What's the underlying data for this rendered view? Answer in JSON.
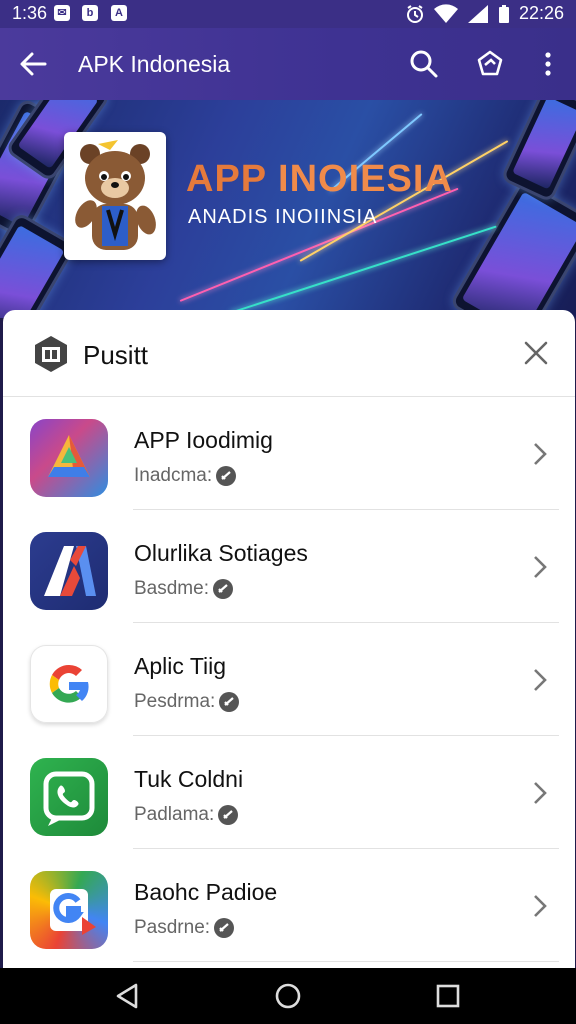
{
  "status_bar": {
    "time_left": "1:36",
    "notifications": [
      "✉",
      "b",
      "A"
    ],
    "time_right": "22:26",
    "icons": [
      "alarm-icon",
      "wifi-icon",
      "signal-icon",
      "battery-icon"
    ]
  },
  "app_bar": {
    "title": "APK Indonesia",
    "back_icon": "arrow-left-icon",
    "actions": [
      "search-icon",
      "share-icon",
      "more-vert-icon"
    ]
  },
  "banner": {
    "headline_part1": "APP ",
    "headline_part2": "INOIESIA",
    "subtitle": "ANADIS INOIINSIA",
    "mascot": "bear-mascot"
  },
  "sheet": {
    "title": "Pusitt",
    "header_icon": "app-box-icon",
    "close_icon": "close-icon",
    "items": [
      {
        "name": "APP Ioodimig",
        "meta": "Inadcma:",
        "icon": "triangle-app-icon",
        "colors": [
          "#8a44c8",
          "#2f8de0"
        ]
      },
      {
        "name": "Olurlika Sotiages",
        "meta": "Basdme:",
        "icon": "a-letter-app-icon",
        "colors": [
          "#2c3c8f",
          "#1e2c72"
        ]
      },
      {
        "name": "Aplic Tiig",
        "meta": "Pesdrma:",
        "icon": "google-g-icon",
        "colors": [
          "#ffffff",
          "#f4f4f4"
        ]
      },
      {
        "name": "Tuk Coldni",
        "meta": "Padlama:",
        "icon": "phone-chat-icon",
        "colors": [
          "#27a745",
          "#1e8a3a"
        ]
      },
      {
        "name": "Baohc Padioe",
        "meta": "Pasdrne:",
        "icon": "g-play-icon",
        "colors": [
          "#ea4335",
          "#fbbc05"
        ]
      }
    ]
  },
  "nav_bar": {
    "buttons": [
      "back-triangle-icon",
      "home-circle-icon",
      "recents-square-icon"
    ]
  }
}
